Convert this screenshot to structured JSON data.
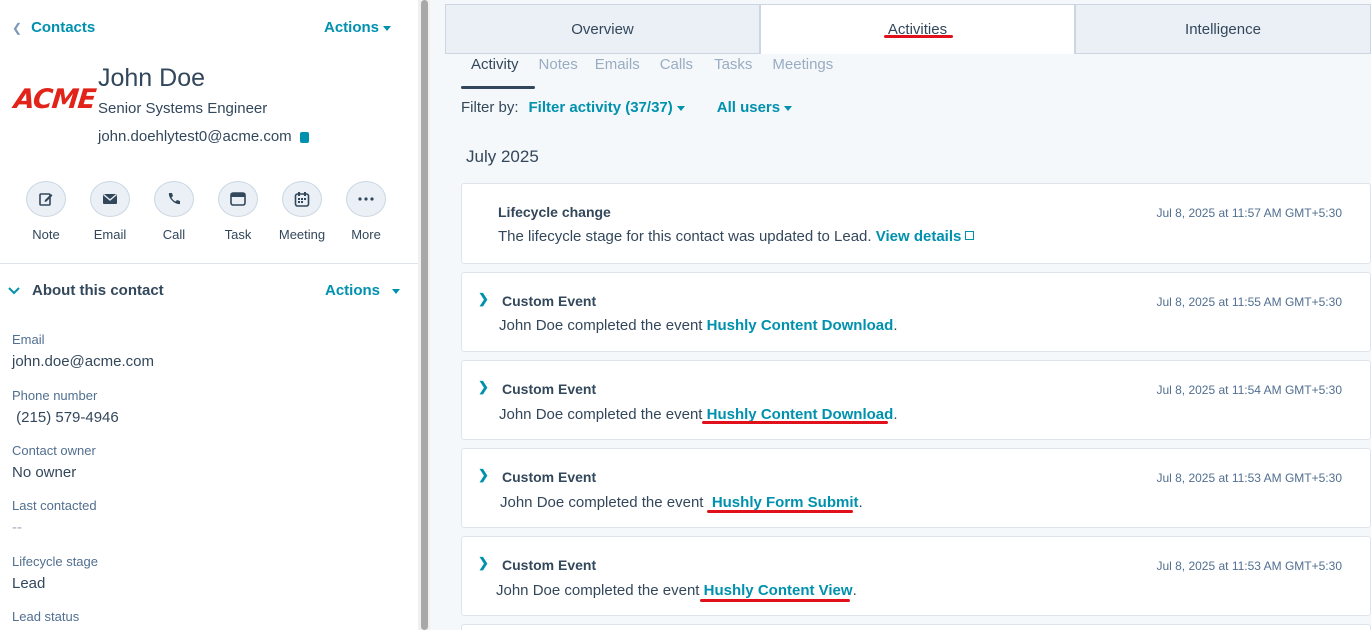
{
  "left": {
    "back_label": "Contacts",
    "actions_label": "Actions",
    "logo_text": "ACME",
    "name": "John Doe",
    "job_title": "Senior Systems Engineer",
    "email": "john.doehlytest0@acme.com",
    "quick_actions": [
      {
        "label": "Note",
        "icon": "edit-icon"
      },
      {
        "label": "Email",
        "icon": "envelope-icon"
      },
      {
        "label": "Call",
        "icon": "phone-icon"
      },
      {
        "label": "Task",
        "icon": "task-icon"
      },
      {
        "label": "Meeting",
        "icon": "calendar-icon"
      },
      {
        "label": "More",
        "icon": "more-icon"
      }
    ],
    "about_title": "About this contact",
    "about_actions": "Actions",
    "properties": [
      {
        "label": "Email",
        "value": "john.doe@acme.com"
      },
      {
        "label": "Phone number",
        "value": " (215) 579-4946"
      },
      {
        "label": "Contact owner",
        "value": "No owner"
      },
      {
        "label": "Last contacted",
        "value": "--"
      },
      {
        "label": "Lifecycle stage",
        "value": "Lead"
      },
      {
        "label": "Lead status",
        "value": ""
      }
    ]
  },
  "right": {
    "tabs": [
      "Overview",
      "Activities",
      "Intelligence"
    ],
    "active_tab": "Activities",
    "subtabs": [
      "Activity",
      "Notes",
      "Emails",
      "Calls",
      "Tasks",
      "Meetings"
    ],
    "active_subtab": "Activity",
    "filter_label": "Filter by:",
    "filter_activity": "Filter activity (37/37)",
    "filter_users": "All users",
    "month": "July 2025",
    "cards": [
      {
        "title": "Lifecycle change",
        "text": "The lifecycle stage for this contact was updated to Lead.",
        "link": "View details",
        "suffix": "",
        "timestamp": "Jul 8, 2025 at 11:57 AM GMT+5:30"
      },
      {
        "title": "Custom Event",
        "text": "John Doe completed the event",
        "link": "Hushly Content Download",
        "suffix": ".",
        "timestamp": "Jul 8, 2025 at 11:55 AM GMT+5:30"
      },
      {
        "title": "Custom Event",
        "text": "John Doe completed the event",
        "link": "Hushly Content Download",
        "suffix": ".",
        "timestamp": "Jul 8, 2025 at 11:54 AM GMT+5:30"
      },
      {
        "title": "Custom Event",
        "text": "John Doe completed the event ",
        "link": "Hushly Form Submit",
        "suffix": ".",
        "timestamp": "Jul 8, 2025 at 11:53 AM GMT+5:30"
      },
      {
        "title": "Custom Event",
        "text": "John Doe completed the event",
        "link": "Hushly Content View",
        "suffix": ".",
        "timestamp": "Jul 8, 2025 at 11:53 AM GMT+5:30"
      }
    ]
  },
  "colors": {
    "accent": "#0091ae",
    "text": "#33475b",
    "annotation_red": "#e0111a",
    "logo_red": "#e2231a"
  }
}
